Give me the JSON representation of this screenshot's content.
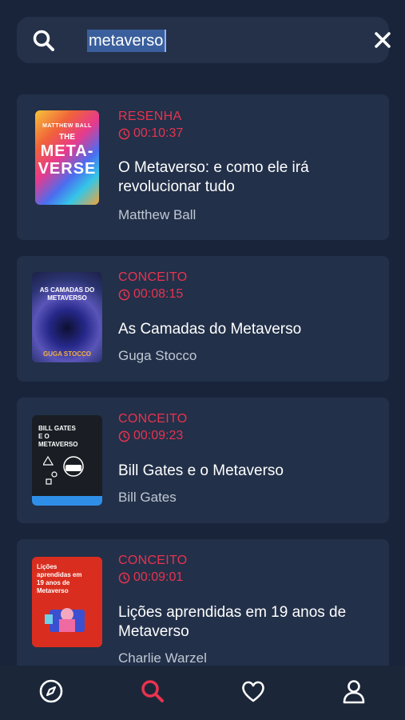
{
  "search": {
    "query": "metaverso"
  },
  "results": [
    {
      "category": "RESENHA",
      "duration": "00:10:37",
      "title": " O Metaverso: e como ele irá revolucionar tudo",
      "author": "Matthew Ball",
      "cover": {
        "author": "MATTHEW BALL",
        "title_line1": "THE",
        "title_line2": "META-",
        "title_line3": "VERSE"
      }
    },
    {
      "category": "CONCEITO",
      "duration": "00:08:15",
      "title": "As Camadas do Metaverso",
      "author": "Guga Stocco",
      "cover": {
        "title": "AS CAMADAS DO METAVERSO",
        "author": "GUGA STOCCO"
      }
    },
    {
      "category": "CONCEITO",
      "duration": "00:09:23",
      "title": "Bill Gates e o Metaverso",
      "author": "Bill Gates",
      "cover": {
        "title": "BILL GATES E O METAVERSO"
      }
    },
    {
      "category": "CONCEITO",
      "duration": "00:09:01",
      "title": "Lições aprendidas em 19 anos de Metaverso",
      "author": "Charlie Warzel",
      "cover": {
        "title": "Lições aprendidas em 19 anos de Metaverso"
      }
    }
  ],
  "colors": {
    "accent": "#e8334f",
    "background": "#19243a",
    "card": "#223049"
  },
  "nav": [
    {
      "icon": "compass-icon",
      "active": false
    },
    {
      "icon": "search-icon",
      "active": true
    },
    {
      "icon": "heart-icon",
      "active": false
    },
    {
      "icon": "user-icon",
      "active": false
    }
  ]
}
